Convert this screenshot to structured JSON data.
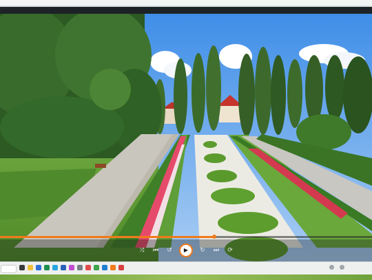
{
  "player": {
    "progress_fraction": 0.575,
    "accent_color": "#f07a1c",
    "video_scene": "garden-aerial",
    "controls": [
      {
        "name": "shuffle-icon",
        "glyph": "⤨"
      },
      {
        "name": "previous-icon",
        "glyph": "⏮"
      },
      {
        "name": "rewind-icon",
        "glyph": "↺"
      },
      {
        "name": "play-icon",
        "glyph": "▶"
      },
      {
        "name": "forward-icon",
        "glyph": "↻"
      },
      {
        "name": "next-icon",
        "glyph": "⏭"
      },
      {
        "name": "repeat-icon",
        "glyph": "⟳"
      }
    ]
  },
  "taskbar": {
    "apps": [
      {
        "name": "file-explorer-icon",
        "color": "#3a3a3a"
      },
      {
        "name": "folder-icon",
        "color": "#f0c23a"
      },
      {
        "name": "mail-icon",
        "color": "#2f6fd6"
      },
      {
        "name": "excel-icon",
        "color": "#1e8e4f"
      },
      {
        "name": "browser-icon",
        "color": "#2aa7e0"
      },
      {
        "name": "word-icon",
        "color": "#2b5fb8"
      },
      {
        "name": "music-icon",
        "color": "#c24bd1"
      },
      {
        "name": "settings-icon",
        "color": "#7a7f86"
      },
      {
        "name": "photos-icon",
        "color": "#e24c4c"
      },
      {
        "name": "chrome-icon",
        "color": "#3fa34d"
      },
      {
        "name": "edge-icon",
        "color": "#1e7fd0"
      },
      {
        "name": "vlc-icon",
        "color": "#f07a1c"
      },
      {
        "name": "media-icon",
        "color": "#d94040"
      }
    ]
  }
}
